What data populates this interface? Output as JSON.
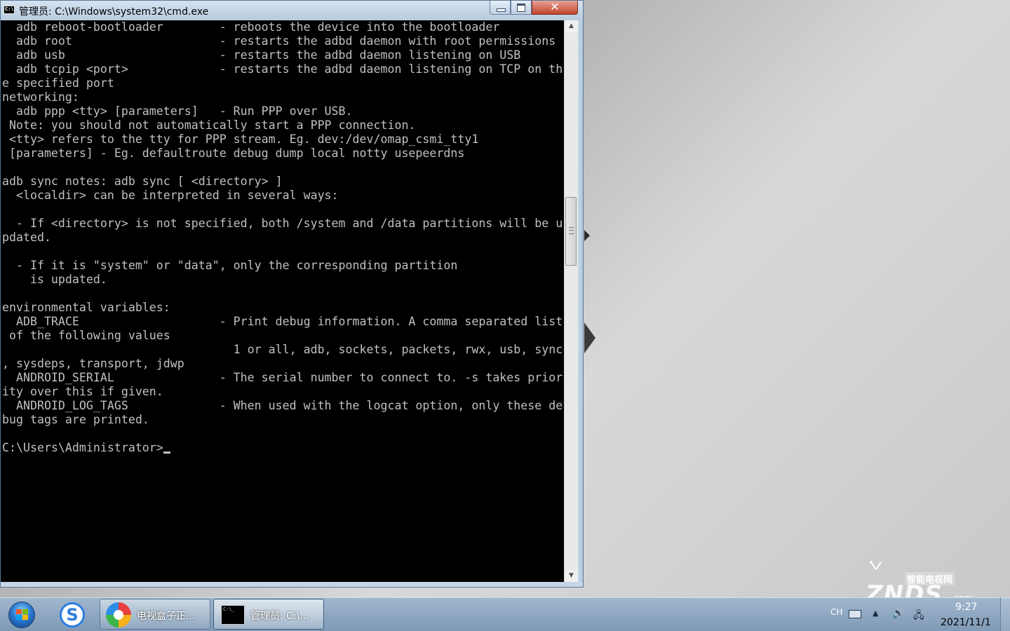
{
  "window": {
    "title": "管理员: C:\\Windows\\system32\\cmd.exe",
    "icon": "cmd-icon",
    "close_glyph": "✕"
  },
  "console": {
    "lines": [
      "  adb reboot-bootloader        - reboots the device into the bootloader",
      "  adb root                     - restarts the adbd daemon with root permissions",
      "  adb usb                      - restarts the adbd daemon listening on USB",
      "  adb tcpip <port>             - restarts the adbd daemon listening on TCP on th",
      "e specified port",
      "networking:",
      "  adb ppp <tty> [parameters]   - Run PPP over USB.",
      " Note: you should not automatically start a PPP connection.",
      " <tty> refers to the tty for PPP stream. Eg. dev:/dev/omap_csmi_tty1",
      " [parameters] - Eg. defaultroute debug dump local notty usepeerdns",
      "",
      "adb sync notes: adb sync [ <directory> ]",
      "  <localdir> can be interpreted in several ways:",
      "",
      "  - If <directory> is not specified, both /system and /data partitions will be u",
      "pdated.",
      "",
      "  - If it is \"system\" or \"data\", only the corresponding partition",
      "    is updated.",
      "",
      "environmental variables:",
      "  ADB_TRACE                    - Print debug information. A comma separated list",
      " of the following values",
      "                                 1 or all, adb, sockets, packets, rwx, usb, sync",
      ", sysdeps, transport, jdwp",
      "  ANDROID_SERIAL               - The serial number to connect to. -s takes prior",
      "ity over this if given.",
      "  ANDROID_LOG_TAGS             - When used with the logcat option, only these de",
      "bug tags are printed.",
      "",
      "C:\\Users\\Administrator>"
    ]
  },
  "scrollbar": {
    "up_glyph": "▲",
    "down_glyph": "▼"
  },
  "colors": {
    "console_bg": "#000000",
    "console_fg": "#c0c0c0",
    "titlebar": "#c6d6e8",
    "close_button": "#c2432c"
  },
  "watermark": {
    "top": "智能电视网",
    "main": "ZNDS",
    "suffix": ".com"
  },
  "taskbar": {
    "tasks": [
      {
        "label": "电视盒子正...",
        "icon": "tv-box-app-icon"
      },
      {
        "label": "管理员: C:\\...",
        "icon": "cmd-icon"
      }
    ],
    "pinned": [
      {
        "icon": "sogou-browser-icon",
        "glyph": "S"
      }
    ]
  },
  "tray": {
    "language": "CH",
    "up_glyph": "▲",
    "volume_glyph": "🔊",
    "network_glyph": "🖧",
    "time": "9:27",
    "date": "2021/11/1"
  }
}
